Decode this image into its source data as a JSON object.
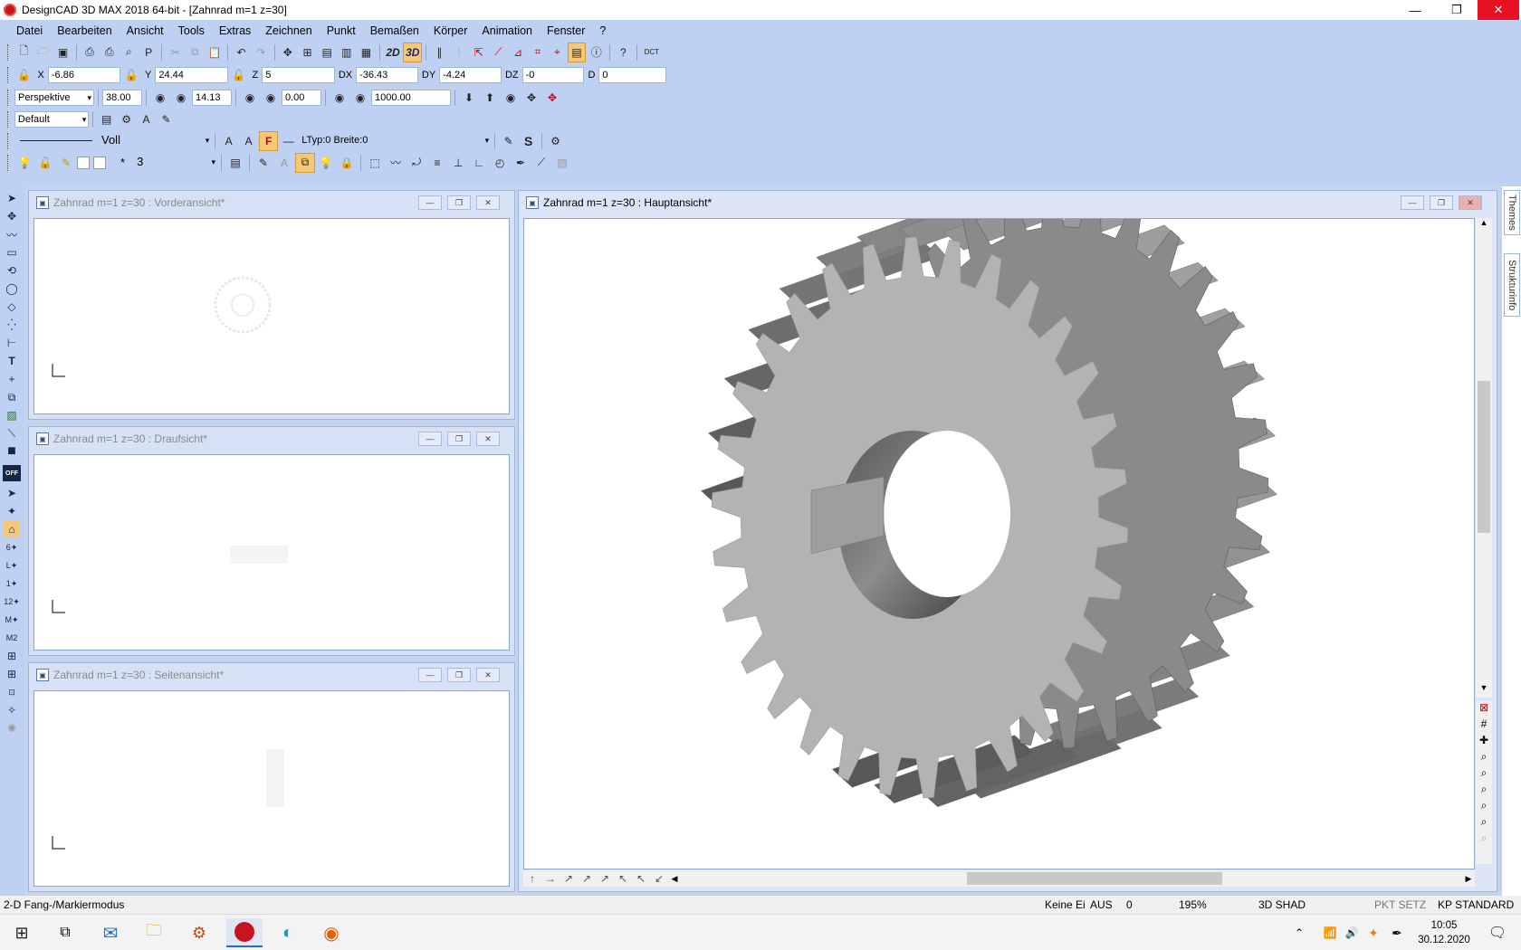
{
  "window": {
    "title": "DesignCAD 3D MAX 2018 64-bit - [Zahnrad m=1  z=30]"
  },
  "menu": [
    "Datei",
    "Bearbeiten",
    "Ansicht",
    "Tools",
    "Extras",
    "Zeichnen",
    "Punkt",
    "Bemaßen",
    "Körper",
    "Animation",
    "Fenster",
    "?"
  ],
  "toolbar": {
    "dct_label": "DCT",
    "mode_2d": "2D",
    "mode_3d": "3D",
    "coords": {
      "x_label": "X",
      "x": "-6.86",
      "y_label": "Y",
      "y": "24.44",
      "z_label": "Z",
      "z": "5",
      "dx_label": "DX",
      "dx": "-36.43",
      "dy_label": "DY",
      "dy": "-4.24",
      "dz_label": "DZ",
      "dz": "-0",
      "d_label": "D",
      "d": "0"
    },
    "view": {
      "projection": "Perspektive",
      "v1": "38.00",
      "v2": "14.13",
      "v3": "0.00",
      "v4": "1000.00"
    },
    "style": {
      "name": "Default"
    },
    "line": {
      "type": "Voll",
      "ltyp": "LTyp:0  Breite:0",
      "f_label": "F",
      "s_label": "S"
    },
    "layer": {
      "star": "*",
      "number": "3"
    }
  },
  "left_toolbar": {
    "off_label": "OFF",
    "t_label": "T"
  },
  "windows": [
    {
      "title": "Zahnrad m=1  z=30 : Vorderansicht*"
    },
    {
      "title": "Zahnrad m=1  z=30 : Draufsicht*"
    },
    {
      "title": "Zahnrad m=1  z=30 : Seitenansicht*"
    },
    {
      "title": "Zahnrad m=1  z=30 : Hauptansicht*"
    }
  ],
  "sidebar_tabs": [
    "Themes",
    "Strukturinfo"
  ],
  "status": {
    "mode": "2-D Fang-/Markiermodus",
    "snap": "Keine Ei",
    "aus": "AUS",
    "zero": "0",
    "zoom": "195%",
    "shade": "3D SHAD",
    "pkt": "PKT SETZ",
    "kp": "KP STANDARD"
  },
  "taskbar": {
    "time": "10:05",
    "date": "30.12.2020"
  },
  "colors": {
    "toolbar_bg": "#bfd1f2",
    "highlight": "#f5c878",
    "close_red": "#e81123"
  }
}
